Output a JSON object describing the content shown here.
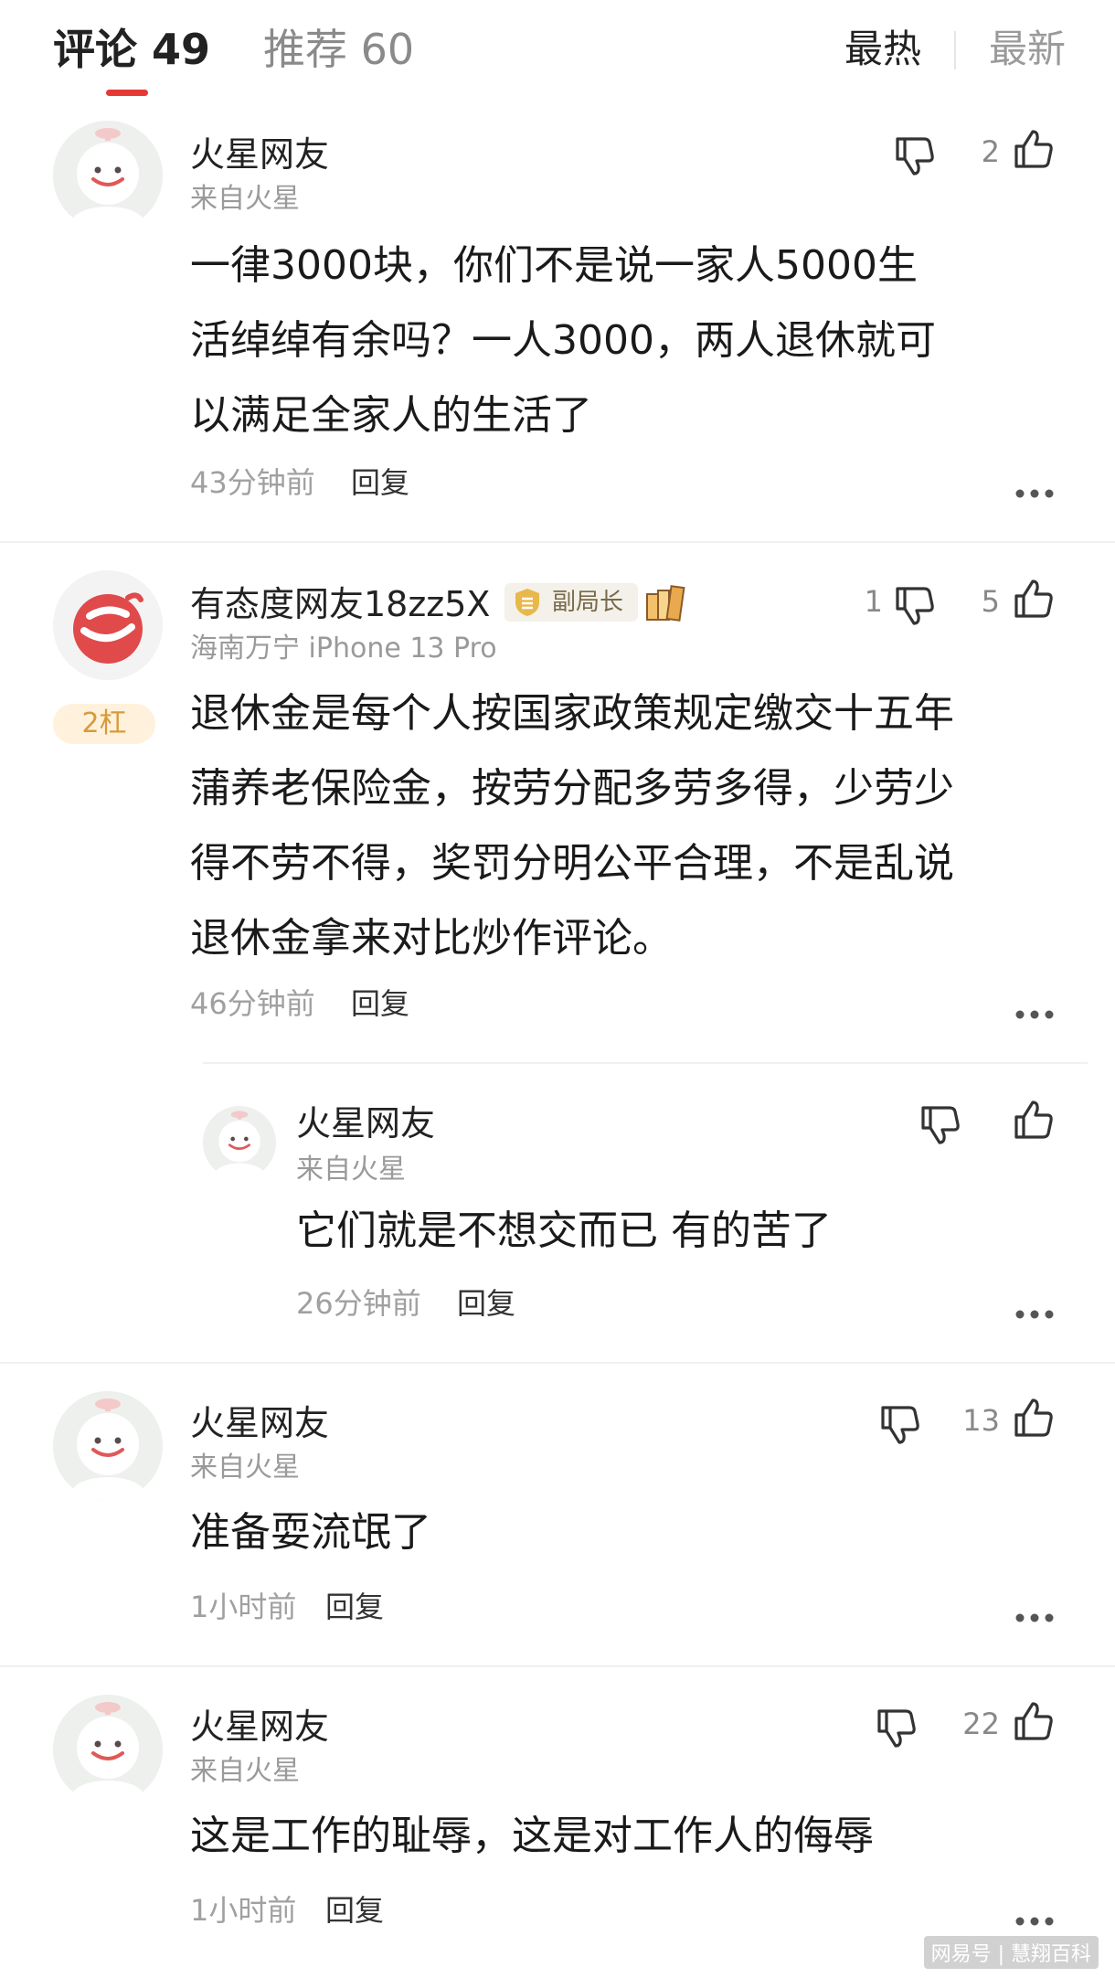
{
  "header": {
    "tab_comments": "评论 49",
    "tab_recommend": "推荐 60",
    "sort_hot": "最热",
    "sort_new": "最新"
  },
  "comments": [
    {
      "user": "火星网友",
      "location": "来自火星",
      "lines": [
        "一律3000块，你们不是说一家人5000生",
        "活绰绰有余吗？一人3000，两人退休就可",
        "以满足全家人的生活了"
      ],
      "time": "43分钟前",
      "reply": "回复",
      "dislikes": "",
      "likes": "2"
    },
    {
      "user": "有态度网友18zz5X",
      "badge_title": "副局长",
      "rank_badge": "2杠",
      "location": "海南万宁  iPhone 13 Pro",
      "lines": [
        "退休金是每个人按国家政策规定缴交十五年",
        "蒲养老保险金，按劳分配多劳多得，少劳少",
        "得不劳不得，奖罚分明公平合理，不是乱说",
        "退休金拿来对比炒作评论。"
      ],
      "time": "46分钟前",
      "reply": "回复",
      "dislikes": "1",
      "likes": "5",
      "sub_reply": {
        "user": "火星网友",
        "location": "来自火星",
        "text": "它们就是不想交而已 有的苦了",
        "time": "26分钟前",
        "reply": "回复",
        "dislikes": "",
        "likes": ""
      }
    },
    {
      "user": "火星网友",
      "location": "来自火星",
      "lines": [
        "准备耍流氓了"
      ],
      "time": "1小时前",
      "reply": "回复",
      "dislikes": "",
      "likes": "13"
    },
    {
      "user": "火星网友",
      "location": "来自火星",
      "lines": [
        "这是工作的耻辱，这是对工作人的侮辱"
      ],
      "time": "1小时前",
      "reply": "回复",
      "dislikes": "",
      "likes": "22"
    }
  ],
  "watermark": "网易号 | 慧翔百科",
  "colors": {
    "accent_red": "#e53935",
    "rank_badge_bg": "#fff1dc",
    "rank_badge_text": "#d89a3a"
  }
}
